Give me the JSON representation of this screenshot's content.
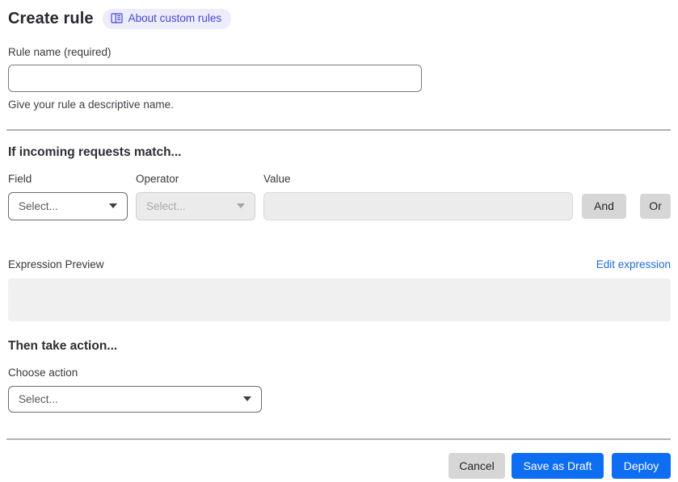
{
  "colors": {
    "primary_blue": "#0d6ef2",
    "link_blue": "#1e6bd6",
    "badge_bg": "#edecfb",
    "badge_text": "#4446d0",
    "disabled_bg": "#ebebeb",
    "neutral_button_bg": "#d6d6d6"
  },
  "header": {
    "title": "Create rule",
    "about_link": "About custom rules"
  },
  "rule_name": {
    "label": "Rule name (required)",
    "value": "",
    "helper": "Give your rule a descriptive name."
  },
  "match_section": {
    "heading": "If incoming requests match...",
    "field": {
      "label": "Field",
      "value": "Select..."
    },
    "operator": {
      "label": "Operator",
      "value": "Select..."
    },
    "value": {
      "label": "Value",
      "value": ""
    },
    "and_button": "And",
    "or_button": "Or"
  },
  "expression": {
    "label": "Expression Preview",
    "edit_link": "Edit expression",
    "preview_value": ""
  },
  "action_section": {
    "heading": "Then take action...",
    "choose_label": "Choose action",
    "value": "Select..."
  },
  "footer": {
    "cancel": "Cancel",
    "save_draft": "Save as Draft",
    "deploy": "Deploy"
  }
}
